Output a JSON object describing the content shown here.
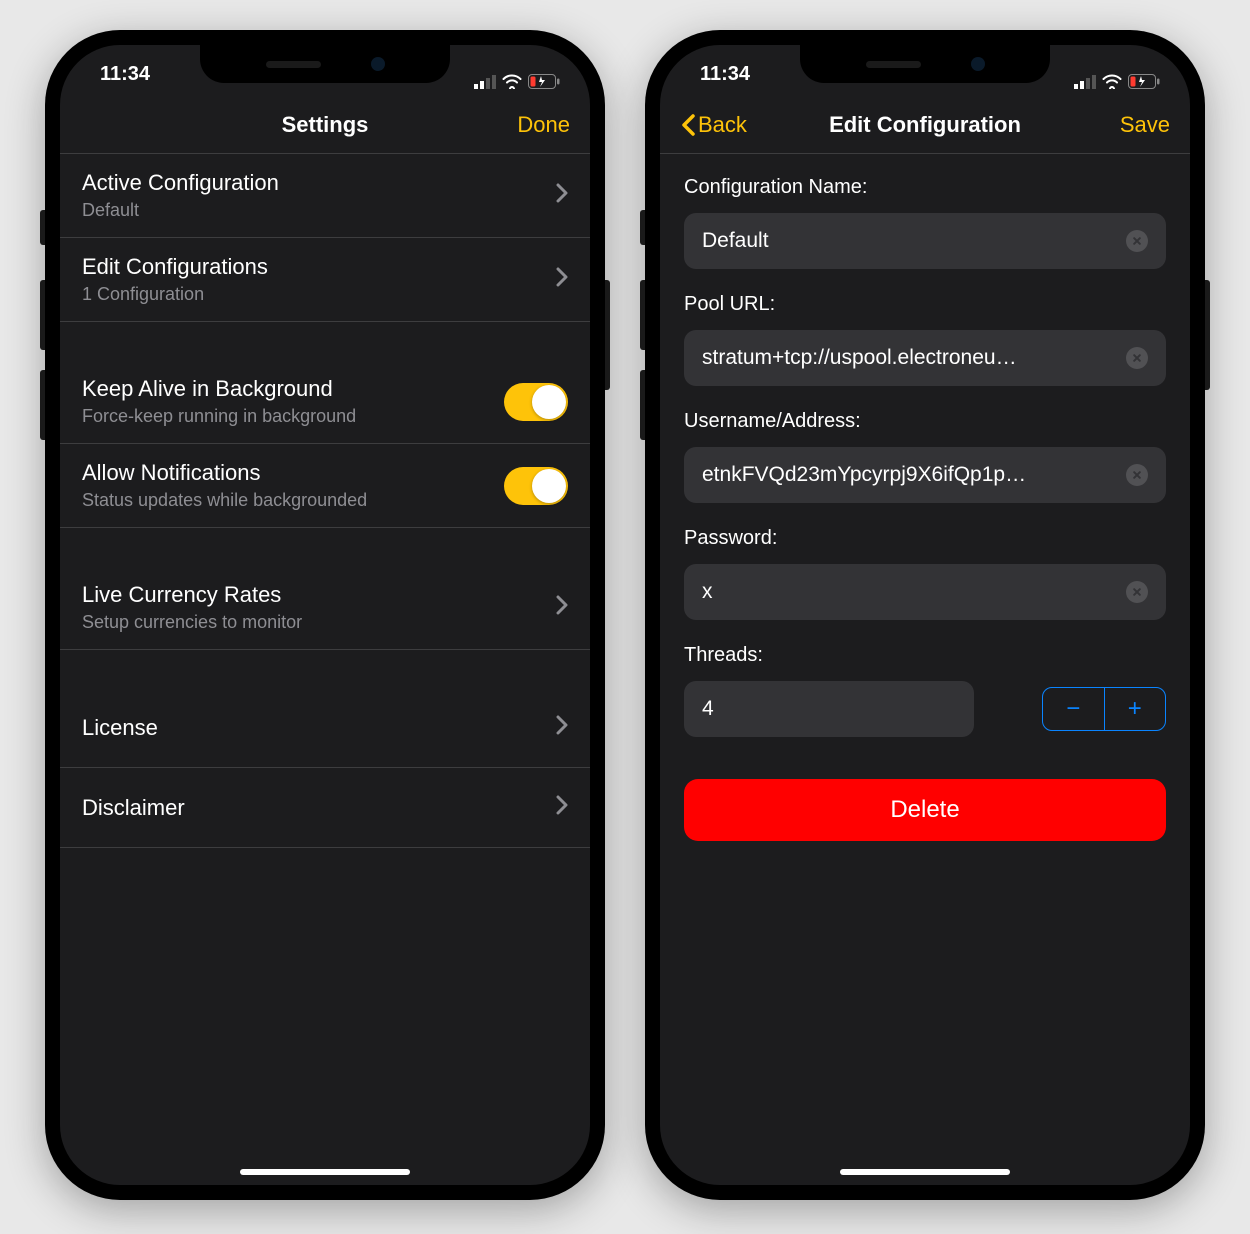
{
  "status": {
    "time": "11:34"
  },
  "colors": {
    "accent": "#fec309",
    "destructive": "#ff0000",
    "stepper": "#0a84ff"
  },
  "left": {
    "nav": {
      "title": "Settings",
      "done": "Done"
    },
    "rows": {
      "active": {
        "title": "Active Configuration",
        "sub": "Default"
      },
      "edit": {
        "title": "Edit Configurations",
        "sub": "1 Configuration"
      },
      "keepalive": {
        "title": "Keep Alive in Background",
        "sub": "Force-keep running in background",
        "on": true
      },
      "notifications": {
        "title": "Allow Notifications",
        "sub": "Status updates while backgrounded",
        "on": true
      },
      "rates": {
        "title": "Live Currency Rates",
        "sub": "Setup currencies to monitor"
      },
      "license": {
        "title": "License"
      },
      "disclaimer": {
        "title": "Disclaimer"
      }
    }
  },
  "right": {
    "nav": {
      "back": "Back",
      "title": "Edit Configuration",
      "save": "Save"
    },
    "fields": {
      "name": {
        "label": "Configuration Name:",
        "value": "Default"
      },
      "pool": {
        "label": "Pool URL:",
        "value": "stratum+tcp://uspool.electroneu…"
      },
      "user": {
        "label": "Username/Address:",
        "value": "etnkFVQd23mYpcyrpj9X6ifQp1p…"
      },
      "password": {
        "label": "Password:",
        "value": "x"
      },
      "threads": {
        "label": "Threads:",
        "value": "4",
        "minus": "−",
        "plus": "+"
      }
    },
    "delete": "Delete"
  }
}
